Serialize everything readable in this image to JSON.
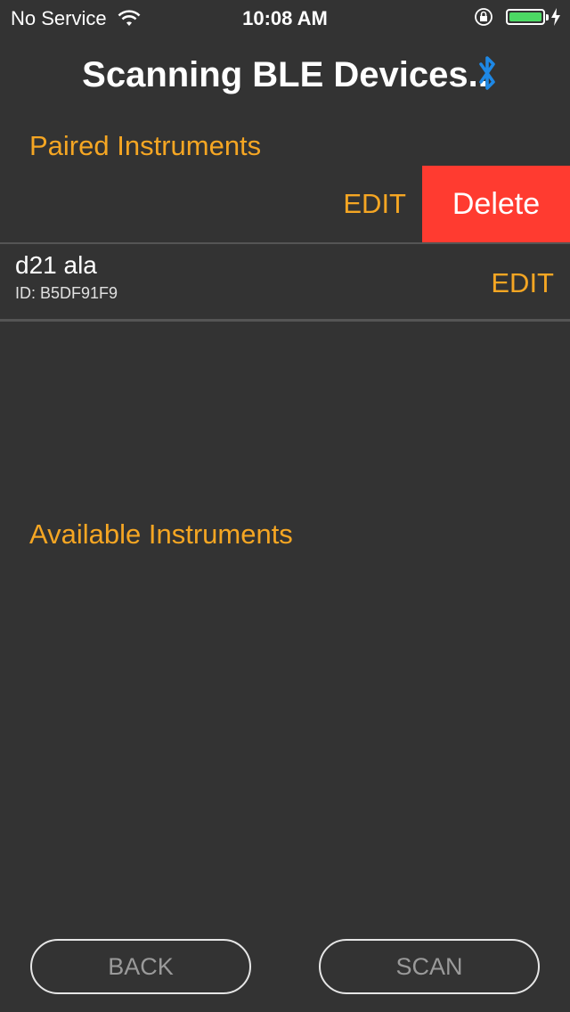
{
  "status_bar": {
    "carrier": "No Service",
    "time": "10:08 AM",
    "battery_color": "#4cd964"
  },
  "title": "Scanning BLE Devices..",
  "title_icon": "bluetooth-icon",
  "paired_section": {
    "header": "Paired Instruments",
    "swiped_row": {
      "edit_label": "EDIT",
      "delete_label": "Delete"
    },
    "devices": [
      {
        "name": "d21 ala",
        "id_text": "ID: B5DF91F9",
        "edit_label": "EDIT"
      }
    ]
  },
  "available_section": {
    "header": "Available Instruments"
  },
  "buttons": {
    "back": "BACK",
    "scan": "SCAN"
  },
  "colors": {
    "background": "#333333",
    "accent": "#f5a623",
    "delete": "#ff3b30",
    "bluetooth": "#1e88e5"
  }
}
